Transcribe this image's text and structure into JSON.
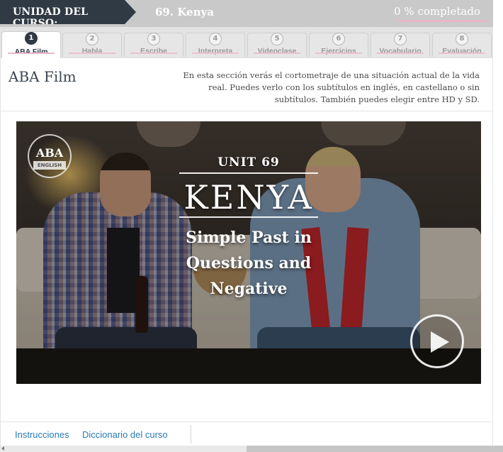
{
  "header": {
    "unit_label": "UNIDAD DEL CURSO:",
    "unit_title": "69. Kenya",
    "progress_text": "0 % completado",
    "progress_fraction": 0
  },
  "tabs": [
    {
      "num": "1",
      "label": "ABA Film",
      "active": true
    },
    {
      "num": "2",
      "label": "Habla"
    },
    {
      "num": "3",
      "label": "Escribe"
    },
    {
      "num": "4",
      "label": "Interpreta"
    },
    {
      "num": "5",
      "label": "Videoclase"
    },
    {
      "num": "6",
      "label": "Ejercicios"
    },
    {
      "num": "7",
      "label": "Vocabulario"
    },
    {
      "num": "8",
      "label": "Evaluación"
    }
  ],
  "section": {
    "title": "ABA Film",
    "description": "En esta sección verás el cortometraje de una situación actual de la vida real. Puedes verlo con los subtítulos en inglés, en castellano o sin subtítulos. También puedes elegir entre HD y SD."
  },
  "video": {
    "logo_text": "ABA",
    "logo_sub": "ENGLISH",
    "unit_overlay": "UNIT 69",
    "name_overlay": "KENYA",
    "subtitle_lines": [
      "Simple Past in",
      "Questions and",
      "Negative"
    ]
  },
  "footer": {
    "link_instructions": "Instrucciones",
    "link_dictionary": "Diccionario del curso"
  },
  "colors": {
    "header_dark": "#2f3a44",
    "accent_pink": "#e9b6c7",
    "link_blue": "#2a7ab8"
  }
}
